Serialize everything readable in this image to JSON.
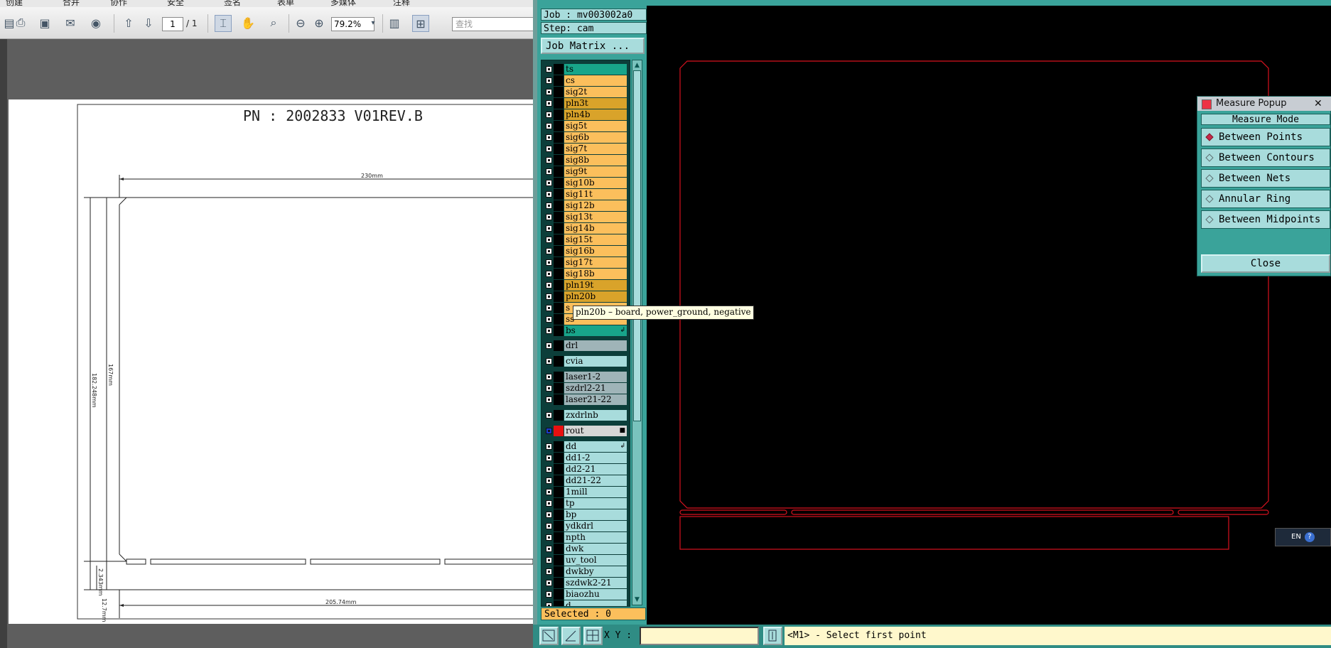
{
  "pdf": {
    "menu": [
      "创建",
      "合并",
      "协作",
      "安全",
      "签名",
      "表单",
      "多媒体",
      "注释"
    ],
    "page_current": "1",
    "page_total": "/ 1",
    "zoom": "79.2%",
    "find_placeholder": "查找",
    "drawing": {
      "title": "PN :    2002833 V01REV.B",
      "dim_width_top": "230mm",
      "dim_height_total": "182.248mm",
      "dim_height_inner": "167mm",
      "dim_bottom_gap": "2.343mm",
      "dim_bottom_margin": "12.7mm",
      "dim_width_bottom": "205.74mm"
    }
  },
  "cam": {
    "job": "Job : mv003002a0",
    "step": "Step: cam",
    "job_matrix": "Job Matrix ...",
    "layers": [
      {
        "name": "ts",
        "color": "#18a58a",
        "mark": ""
      },
      {
        "name": "cs",
        "color": "#fbbf5c",
        "mark": ""
      },
      {
        "name": "sig2t",
        "color": "#fbbf5c",
        "mark": ""
      },
      {
        "name": "pln3t",
        "color": "#d9a32a",
        "mark": ""
      },
      {
        "name": "pln4b",
        "color": "#d9a32a",
        "mark": ""
      },
      {
        "name": "sig5t",
        "color": "#fbbf5c",
        "mark": ""
      },
      {
        "name": "sig6b",
        "color": "#fbbf5c",
        "mark": ""
      },
      {
        "name": "sig7t",
        "color": "#fbbf5c",
        "mark": ""
      },
      {
        "name": "sig8b",
        "color": "#fbbf5c",
        "mark": ""
      },
      {
        "name": "sig9t",
        "color": "#fbbf5c",
        "mark": ""
      },
      {
        "name": "sig10b",
        "color": "#fbbf5c",
        "mark": ""
      },
      {
        "name": "sig11t",
        "color": "#fbbf5c",
        "mark": ""
      },
      {
        "name": "sig12b",
        "color": "#fbbf5c",
        "mark": ""
      },
      {
        "name": "sig13t",
        "color": "#fbbf5c",
        "mark": ""
      },
      {
        "name": "sig14b",
        "color": "#fbbf5c",
        "mark": ""
      },
      {
        "name": "sig15t",
        "color": "#fbbf5c",
        "mark": ""
      },
      {
        "name": "sig16b",
        "color": "#fbbf5c",
        "mark": ""
      },
      {
        "name": "sig17t",
        "color": "#fbbf5c",
        "mark": ""
      },
      {
        "name": "sig18b",
        "color": "#fbbf5c",
        "mark": ""
      },
      {
        "name": "pln19t",
        "color": "#d9a32a",
        "mark": ""
      },
      {
        "name": "pln20b",
        "color": "#d9a32a",
        "mark": ""
      },
      {
        "name": "s",
        "color": "#fbbf5c",
        "mark": ""
      },
      {
        "name": "ss",
        "color": "#fbbf5c",
        "mark": ""
      },
      {
        "name": "bs",
        "color": "#18a58a",
        "mark": "↲"
      }
    ],
    "drill_layers": [
      {
        "name": "drl",
        "color": "#9fb4b8",
        "mark": "",
        "gap": true
      },
      {
        "name": "cvia",
        "color": "#a8dcdc",
        "mark": "",
        "gap": true
      },
      {
        "name": "laser1-2",
        "color": "#9fb4b8",
        "mark": "",
        "gap": true
      },
      {
        "name": "szdrl2-21",
        "color": "#9fb4b8",
        "mark": "",
        "gap": false
      },
      {
        "name": "laser21-22",
        "color": "#9fb4b8",
        "mark": "",
        "gap": false
      },
      {
        "name": "zxdrlnb",
        "color": "#a8dcdc",
        "mark": "",
        "gap": true
      },
      {
        "name": "rout",
        "color": "#d6d6d6",
        "mark": "■",
        "gap": true
      },
      {
        "name": "dd",
        "color": "#a8dcdc",
        "mark": "↲",
        "gap": true
      },
      {
        "name": "dd1-2",
        "color": "#a8dcdc",
        "mark": "",
        "gap": false
      },
      {
        "name": "dd2-21",
        "color": "#a8dcdc",
        "mark": "",
        "gap": false
      },
      {
        "name": "dd21-22",
        "color": "#a8dcdc",
        "mark": "",
        "gap": false
      },
      {
        "name": "1mill",
        "color": "#a8dcdc",
        "mark": "",
        "gap": false
      },
      {
        "name": "tp",
        "color": "#a8dcdc",
        "mark": "",
        "gap": false
      },
      {
        "name": "bp",
        "color": "#a8dcdc",
        "mark": "",
        "gap": false
      },
      {
        "name": "ydkdrl",
        "color": "#a8dcdc",
        "mark": "",
        "gap": false
      },
      {
        "name": "npth",
        "color": "#a8dcdc",
        "mark": "",
        "gap": false
      },
      {
        "name": "dwk",
        "color": "#a8dcdc",
        "mark": "",
        "gap": false
      },
      {
        "name": "uv_tool",
        "color": "#a8dcdc",
        "mark": "",
        "gap": false
      },
      {
        "name": "dwkby",
        "color": "#a8dcdc",
        "mark": "",
        "gap": false
      },
      {
        "name": "szdwk2-21",
        "color": "#a8dcdc",
        "mark": "",
        "gap": false
      },
      {
        "name": "biaozhu",
        "color": "#a8dcdc",
        "mark": "",
        "gap": false
      },
      {
        "name": "d",
        "color": "#a8dcdc",
        "mark": "",
        "gap": false
      }
    ],
    "tooltip": "pln20b – board, power_ground, negative",
    "selected": "Selected : 0",
    "xy_label": "X Y :",
    "xy_value": "",
    "status": "<M1> - Select first point"
  },
  "measure": {
    "title": "Measure Popup",
    "close_x": "✕",
    "mode_label": "Measure Mode",
    "options": [
      {
        "label": "Between Points",
        "selected": true
      },
      {
        "label": "Between Contours",
        "selected": false
      },
      {
        "label": "Between Nets",
        "selected": false
      },
      {
        "label": "Annular Ring",
        "selected": false
      },
      {
        "label": "Between Midpoints",
        "selected": false
      }
    ],
    "close_label": "Close"
  },
  "taskbar": {
    "lang": "EN",
    "help": "?"
  }
}
